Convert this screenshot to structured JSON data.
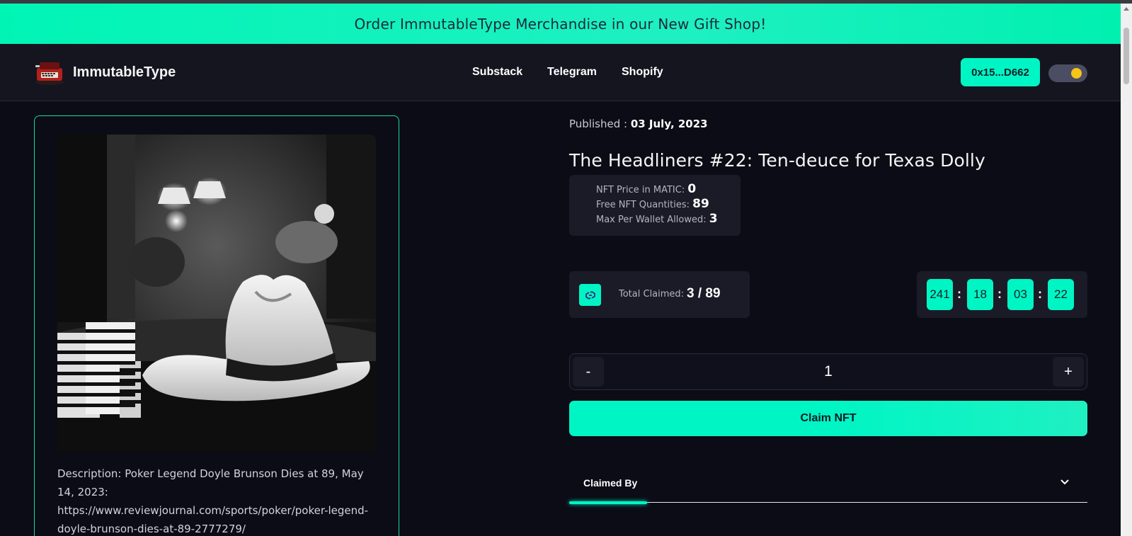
{
  "banner": {
    "text": "Order ImmutableType Merchandise in our New Gift Shop!"
  },
  "header": {
    "brand": "ImmutableType",
    "nav": [
      "Substack",
      "Telegram",
      "Shopify"
    ],
    "wallet": "0x15...D662"
  },
  "nft": {
    "published_label": "Published :",
    "published_date": "03 July, 2023",
    "title": "The Headliners #22: Ten-deuce for Texas Dolly",
    "price_label": "NFT Price in MATIC:",
    "price_value": "0",
    "quantity_label": "Free NFT Quantities:",
    "quantity_value": "89",
    "max_label": "Max Per Wallet Allowed:",
    "max_value": "3",
    "claimed_label": "Total Claimed:",
    "claimed_value": "3 / 89",
    "timer": [
      "241",
      "18",
      "03",
      "22"
    ],
    "quantity": "1",
    "minus": "-",
    "plus": "+",
    "claim_button": "Claim NFT",
    "claimed_by": "Claimed By",
    "description": "Description: Poker Legend Doyle Brunson Dies at 89, May 14, 2023: https://www.reviewjournal.com/sports/poker/poker-legend-doyle-brunson-dies-at-89-2777279/"
  },
  "icons": {
    "logo": "typewriter-logo-icon",
    "chain": "polygon-link-icon",
    "chevron": "chevron-down-icon"
  },
  "colors": {
    "accent": "#00f5c4",
    "background": "#0b0c16",
    "header": "#14151f",
    "panel": "#1a1b27",
    "theme_knob": "#f5c518"
  }
}
